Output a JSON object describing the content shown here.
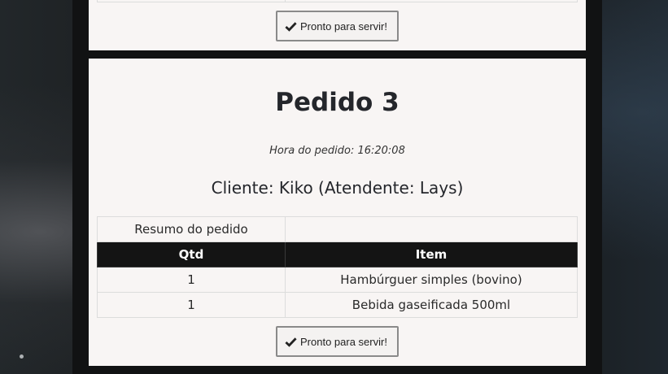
{
  "previous_order": {
    "ready_button_label": "Pronto para servir!"
  },
  "order": {
    "title": "Pedido 3",
    "time_text": "Hora do pedido: 16:20:08",
    "client_text": "Cliente: Kiko (Atendente: Lays)",
    "summary_label": "Resumo do pedido",
    "summary_value": "",
    "columns": {
      "qty": "Qtd",
      "item": "Item"
    },
    "rows": [
      {
        "qty": "1",
        "item": "Hambúrguer simples (bovino)"
      },
      {
        "qty": "1",
        "item": "Bebida gaseificada 500ml"
      }
    ],
    "ready_button_label": "Pronto para servir!"
  },
  "icons": {
    "ready_button_icon": "check-icon"
  },
  "colors": {
    "card_background": "#f8f5f4",
    "table_header_background": "#141414",
    "table_header_text": "#ffffff"
  }
}
